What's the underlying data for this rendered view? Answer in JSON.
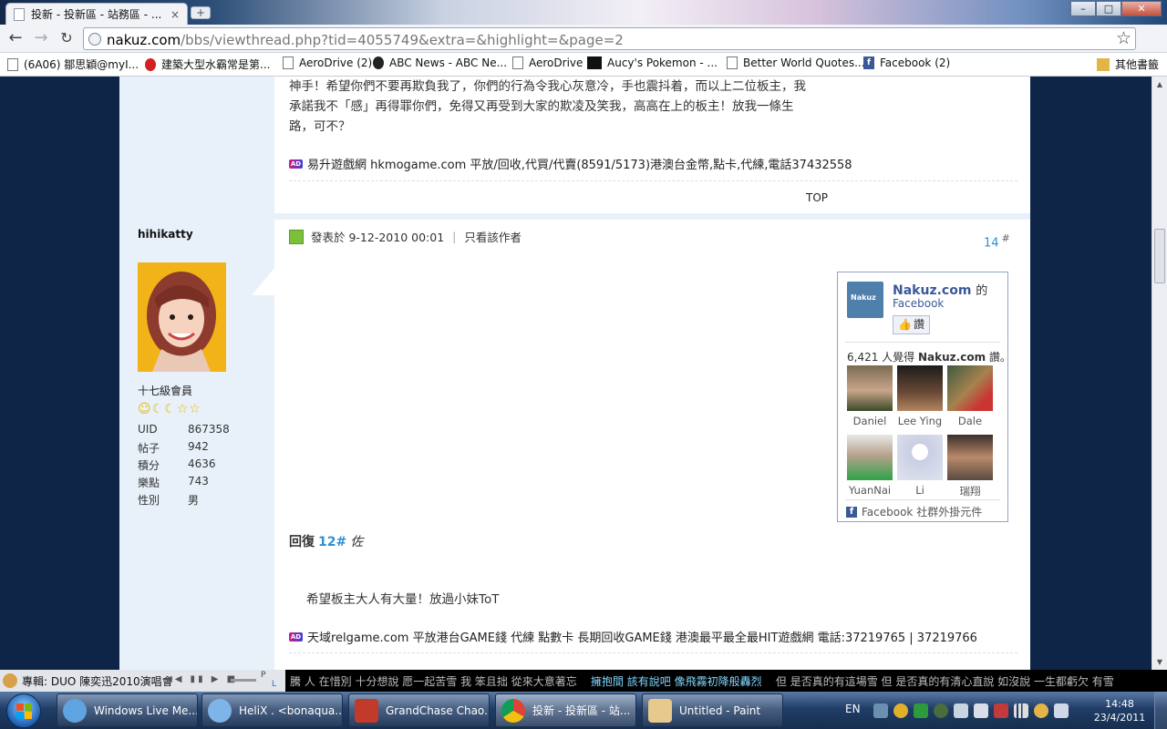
{
  "browser": {
    "tab_title": "投新 - 投新區 - 站務區 - ...",
    "tab_close": "×",
    "new_tab": "+",
    "url_domain": "nakuz.com",
    "url_path": "/bbs/viewthread.php?tid=4055749&extra=&highlight=&page=2",
    "window_buttons": [
      "–",
      "□",
      "✕"
    ]
  },
  "bookmarks": [
    {
      "label": "(6A06) 鄒思穎@myI...",
      "icon": "page-icon"
    },
    {
      "label": "建築大型水霸常是第...",
      "icon": "red-logo-icon"
    },
    {
      "label": "AeroDrive (2)",
      "icon": "page-icon"
    },
    {
      "label": "ABC News - ABC Ne...",
      "icon": "abc-logo-icon"
    },
    {
      "label": "AeroDrive",
      "icon": "page-icon"
    },
    {
      "label": "Aucy's Pokemon - ...",
      "icon": "aucy-logo-icon"
    },
    {
      "label": "Better World Quotes...",
      "icon": "page-icon"
    },
    {
      "label": "Facebook (2)",
      "icon": "facebook-icon"
    }
  ],
  "other_bookmarks": "其他書籤",
  "prev_post": {
    "lines": [
      "神手！希望你們不要再欺負我了，你們的行為令我心灰意冷，手也震抖着，而以上二位板主，我",
      "承諾我不「感」再得罪你們，免得又再受到大家的欺凌及笑我，高高在上的板主！放我一條生",
      "路，可不？"
    ],
    "ad_badge": "AD",
    "ad_text": "易升遊戲網 hkmogame.com 平放/回收,代買/代賣(8591/5173)港澳台金幣,點卡,代練,電話37432558",
    "top_link": "TOP"
  },
  "post": {
    "author": "hihikatty",
    "rank": "十七級會員",
    "stats": [
      {
        "label": "UID",
        "value": "867358"
      },
      {
        "label": "帖子",
        "value": "942"
      },
      {
        "label": "積分",
        "value": "4636"
      },
      {
        "label": "樂點",
        "value": "743"
      },
      {
        "label": "性別",
        "value": "男"
      }
    ],
    "posted_at": "發表於 9-12-2010 00:01",
    "only_author": "只看該作者",
    "floor": "14",
    "floor_sup": "#",
    "reply_prefix": "回復",
    "reply_num": "12#",
    "reply_to": "佐",
    "message": "希望板主大人有大量！放過小妹ToT",
    "ad_badge": "AD",
    "ad_text": "天域relgame.com 平放港台GAME錢 代練 點數卡 長期回收GAME錢 港澳最平最全最HIT遊戲網 電話:37219765 | 37219766"
  },
  "facebook_box": {
    "page_name": "Nakuz.com",
    "page_suffix": "的",
    "sub": "Facebook",
    "logo_text": "Nakuz",
    "like_thumb": "👍",
    "like_button": "讚",
    "count_prefix": "6,421 人覺得",
    "count_name": "Nakuz.com",
    "count_suffix": "讚。",
    "fans": [
      "Daniel",
      "Lee Ying",
      "Dale",
      "YuanNai",
      "Li",
      "瑞翔"
    ],
    "plugin_label": "Facebook 社群外掛元件"
  },
  "ticker": {
    "player_text": "專輯: DUO 陳奕迅2010演唱會",
    "player_controls": "◀◀ ▮▮ ▶ ■",
    "mini_label_1": "P",
    "mini_label_2": "L",
    "marquee_1": "騰    人 在惜別 十分想說 愿一起苦雪    我 笨且拙 從來大意著忘",
    "marquee_hi": "擁抱間 該有說吧 像飛霧初降般轟烈",
    "marquee_2": "但 是否真的有這場雪    但 是否真的有清心直說    如沒說 一生都虧欠    有雪"
  },
  "taskbar": {
    "tasks": [
      {
        "label": "Windows Live Me...",
        "color": "#5fa3e0"
      },
      {
        "label": "HeliX . <bonaqua...",
        "color": "#7fb4e8"
      },
      {
        "label": "GrandChase Chao...",
        "color": "#c23a2a"
      },
      {
        "label": "投新 - 投新區 - 站...",
        "color": "#e0c23a"
      },
      {
        "label": "Untitled - Paint",
        "color": "#e7c98e"
      }
    ],
    "lang": "EN",
    "time": "14:48",
    "date": "23/4/2011"
  }
}
